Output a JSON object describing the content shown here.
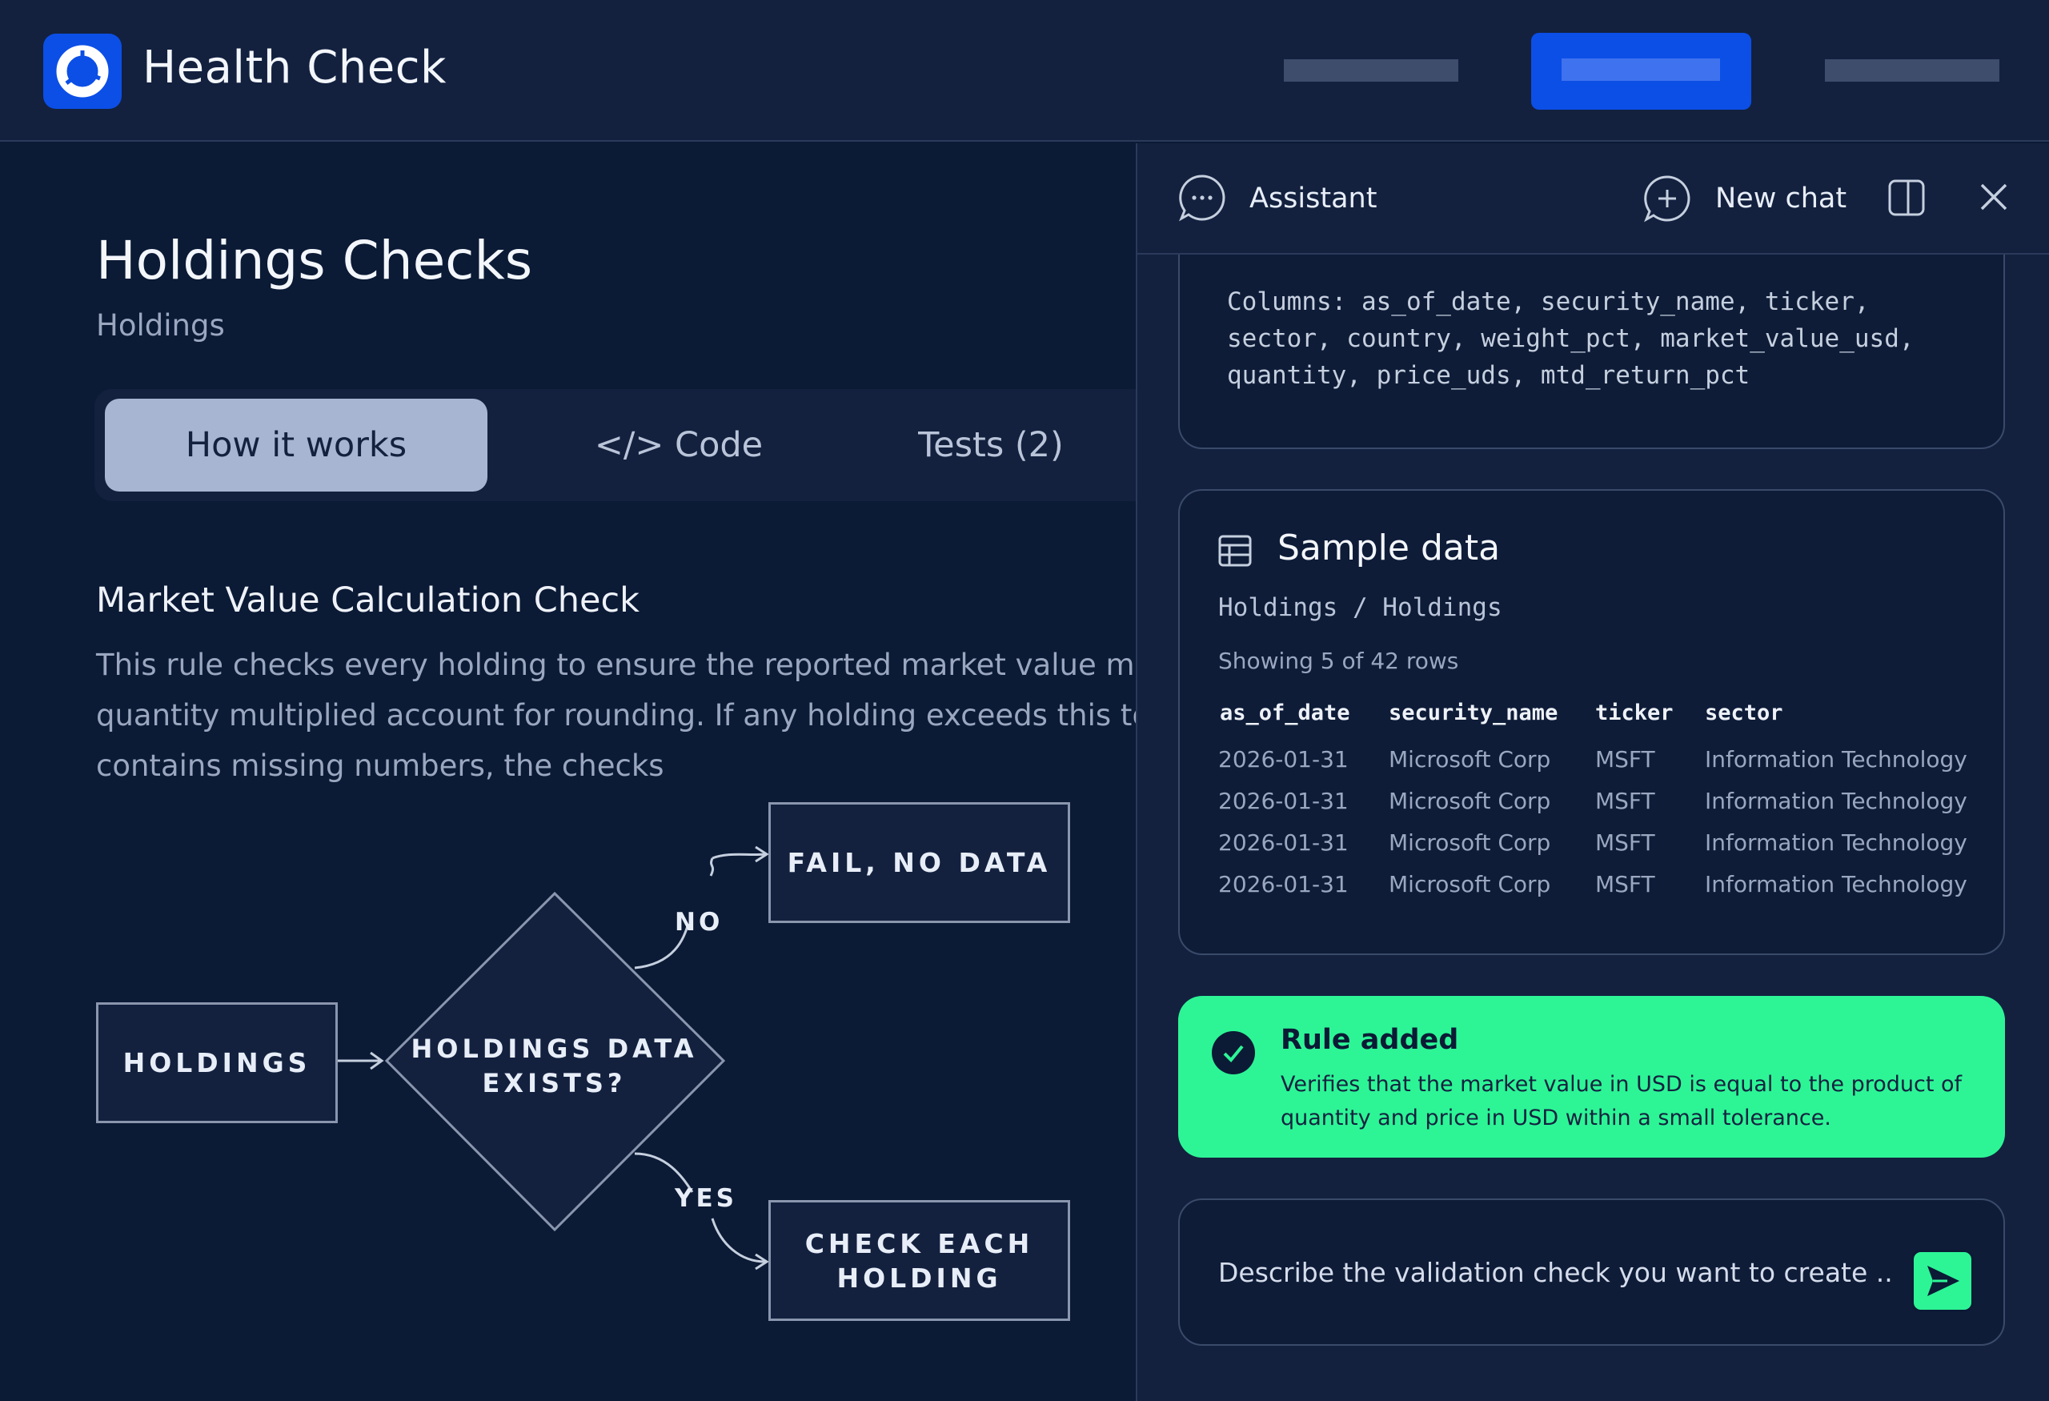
{
  "header": {
    "app_title": "Health Check"
  },
  "page": {
    "title": "Holdings Checks",
    "subtitle": "Holdings",
    "tabs": [
      {
        "label": "How it works",
        "active": true
      },
      {
        "label": "</> Code",
        "active": false
      },
      {
        "label": "Tests (2)",
        "active": false
      }
    ],
    "section_title": "Market Value Calculation Check",
    "description_lines": [
      "This rule checks every holding to ensure the reported market value matches t",
      "quantity multiplied account for rounding. If any holding exceeds this toleranc",
      "contains missing numbers, the checks"
    ]
  },
  "flowchart": {
    "start": "HOLDINGS",
    "decision": "HOLDINGS DATA EXISTS?",
    "no_label": "NO",
    "yes_label": "YES",
    "no_outcome": "FAIL, NO DATA",
    "yes_outcome": "CHECK EACH HOLDING"
  },
  "assistant": {
    "title": "Assistant",
    "new_chat_label": "New chat",
    "columns_lines": [
      "Columns: as_of_date, security_name, ticker,",
      "sector, country, weight_pct, market_value_usd,",
      "quantity, price_uds, mtd_return_pct"
    ],
    "sample_data": {
      "title": "Sample data",
      "path": "Holdings / Holdings",
      "count_text": "Showing 5 of 42 rows",
      "columns": [
        "as_of_date",
        "security_name",
        "ticker",
        "sector"
      ],
      "rows": [
        [
          "2026-01-31",
          "Microsoft Corp",
          "MSFT",
          "Information Technology"
        ],
        [
          "2026-01-31",
          "Microsoft Corp",
          "MSFT",
          "Information Technology"
        ],
        [
          "2026-01-31",
          "Microsoft Corp",
          "MSFT",
          "Information Technology"
        ],
        [
          "2026-01-31",
          "Microsoft Corp",
          "MSFT",
          "Information Technology"
        ]
      ]
    },
    "toast": {
      "title": "Rule added",
      "body": "Verifies that the market value in USD is equal to the product of quantity and price in USD within a small tolerance."
    },
    "input_placeholder": "Describe the validation check you want to create ..."
  },
  "colors": {
    "background": "#0b1a35",
    "surface": "#13213f",
    "accent_blue": "#0c4fe6",
    "success_green": "#2df596",
    "tab_active": "#a7b4d2"
  },
  "icons": {
    "logo": "donut-logo-icon",
    "assistant": "chat-bubble-icon",
    "new_chat": "plus-circle-icon",
    "split_view": "split-panel-icon",
    "close": "close-icon",
    "table": "table-icon",
    "check": "check-circle-icon",
    "send": "send-icon"
  }
}
